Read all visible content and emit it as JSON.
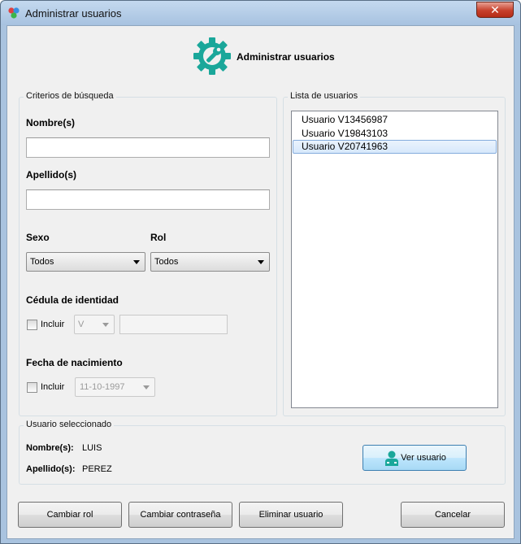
{
  "window": {
    "title": "Administrar usuarios",
    "close_glyph": "✕"
  },
  "header": {
    "title": "Administrar usuarios",
    "icon": "gear-wrench-icon",
    "accent": "#1aa79a"
  },
  "search": {
    "group_title": "Criterios de búsqueda",
    "nombres_label": "Nombre(s)",
    "nombres_value": "",
    "apellidos_label": "Apellido(s)",
    "apellidos_value": "",
    "sexo_label": "Sexo",
    "sexo_value": "Todos",
    "rol_label": "Rol",
    "rol_value": "Todos",
    "cedula_label": "Cédula de identidad",
    "cedula_incluir": "Incluir",
    "cedula_prefix": "V",
    "cedula_value": "",
    "fecha_label": "Fecha de nacimiento",
    "fecha_incluir": "Incluir",
    "fecha_value": "11-10-1997"
  },
  "users": {
    "group_title": "Lista de usuarios",
    "items": [
      {
        "label": "Usuario V13456987"
      },
      {
        "label": "Usuario V19843103"
      },
      {
        "label": "Usuario V20741963"
      }
    ],
    "selected_index": 2
  },
  "selected": {
    "group_title": "Usuario seleccionado",
    "nombres_label": "Nombre(s):",
    "nombres_value": "LUIS",
    "apellidos_label": "Apellido(s):",
    "apellidos_value": "PEREZ",
    "ver_button": "Ver usuario"
  },
  "footer": {
    "cambiar_rol": "Cambiar rol",
    "cambiar_contrasena": "Cambiar contraseña",
    "eliminar_usuario": "Eliminar usuario",
    "cancelar": "Cancelar"
  }
}
